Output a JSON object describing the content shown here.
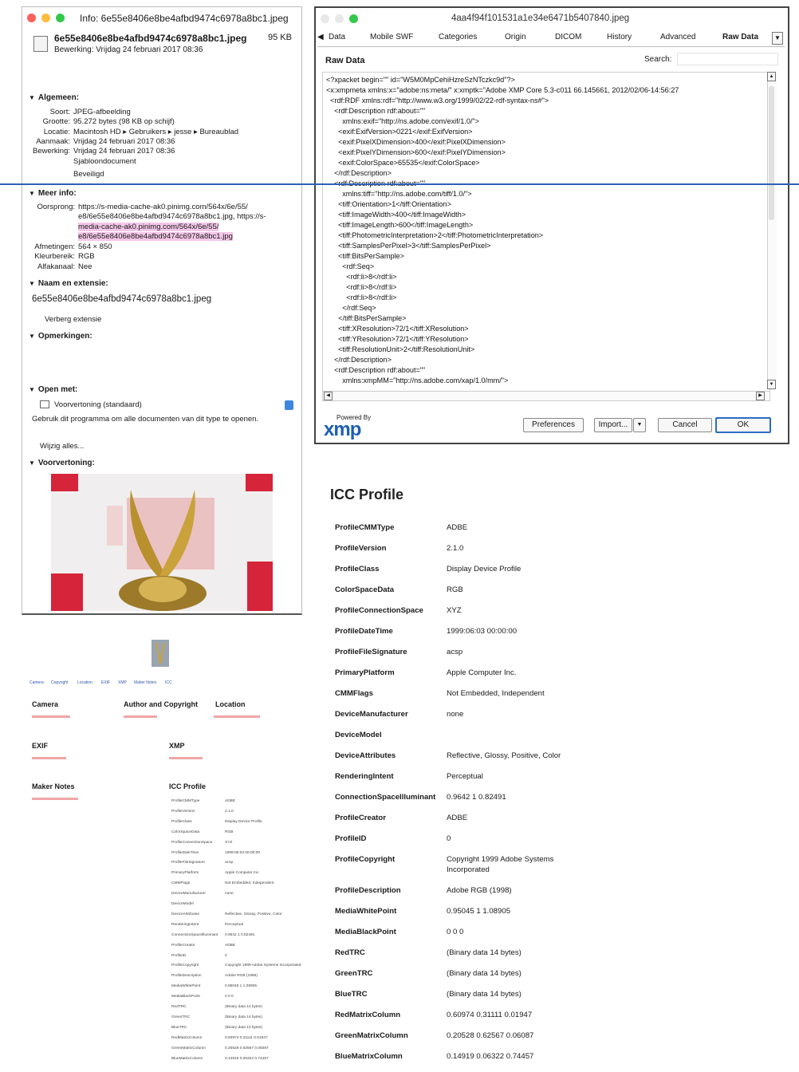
{
  "info_window": {
    "title": "Info: 6e55e8406e8be4afbd9474c6978a8bc1.jpeg",
    "file_name": "6e55e8406e8be4afbd9474c6978a8bc1.jpeg",
    "file_size": "95 KB",
    "edited": "Bewerking: Vrijdag 24 februari 2017 08:36",
    "general": {
      "label": "Algemeen:",
      "rows": [
        {
          "k": "Soort:",
          "v": "JPEG-afbeelding"
        },
        {
          "k": "Grootte:",
          "v": "95.272 bytes (98 KB op schijf)"
        },
        {
          "k": "Locatie:",
          "v": "Macintosh HD ▸ Gebruikers ▸ jesse ▸ Bureaublad"
        },
        {
          "k": "Aanmaak:",
          "v": "Vrijdag 24 februari 2017 08:36"
        },
        {
          "k": "Bewerking:",
          "v": "Vrijdag 24 februari 2017 08:36"
        }
      ],
      "template_label": "Sjabloondocument",
      "locked_label": "Beveiligd"
    },
    "more_info": {
      "label": "Meer info:",
      "origin_key": "Oorsprong:",
      "origin_lines": [
        "https://s-media-cache-ak0.pinimg.com/564x/6e/55/",
        "e8/6e55e8406e8be4afbd9474c6978a8bc1.jpg, https://s-",
        "media-cache-ak0.pinimg.com/564x/6e/55/",
        "e8/6e55e8406e8be4afbd9474c6978a8bc1.jpg"
      ],
      "rows": [
        {
          "k": "Afmetingen:",
          "v": "564 × 850"
        },
        {
          "k": "Kleurbereik:",
          "v": "RGB"
        },
        {
          "k": "Alfakanaal:",
          "v": "Nee"
        }
      ]
    },
    "name_ext": {
      "label": "Naam en extensie:",
      "value": "6e55e8406e8be4afbd9474c6978a8bc1.jpeg",
      "hide_ext": "Verberg extensie"
    },
    "comments": {
      "label": "Opmerkingen:"
    },
    "open_with": {
      "label": "Open met:",
      "app": "Voorvertoning (standaard)",
      "note": "Gebruik dit programma om alle documenten van dit type te openen.",
      "change_all": "Wijzig alles..."
    },
    "preview": {
      "label": "Voorvertoning:"
    }
  },
  "raw_dialog": {
    "title": "4aa4f94f101531a1e34e6471b5407840.jpeg",
    "tabs": [
      "Data",
      "Mobile SWF",
      "Categories",
      "Origin",
      "DICOM",
      "History",
      "Advanced",
      "Raw Data"
    ],
    "active_tab": "Raw Data",
    "header": "Raw Data",
    "search_label": "Search:",
    "xml_lines": [
      "<?xpacket begin=\"\" id=\"W5M0MpCehiHzreSzNTczkc9d\"?>",
      "<x:xmpmeta xmlns:x=\"adobe:ns:meta/\" x:xmptk=\"Adobe XMP Core 5.3-c011 66.145661, 2012/02/06-14:56:27",
      "  <rdf:RDF xmlns:rdf=\"http://www.w3.org/1999/02/22-rdf-syntax-ns#\">",
      "    <rdf:Description rdf:about=\"\"",
      "        xmlns:exif=\"http://ns.adobe.com/exif/1.0/\">",
      "      <exif:ExifVersion>0221</exif:ExifVersion>",
      "      <exif:PixelXDimension>400</exif:PixelXDimension>",
      "      <exif:PixelYDimension>600</exif:PixelYDimension>",
      "      <exif:ColorSpace>65535</exif:ColorSpace>",
      "    </rdf:Description>",
      "    <rdf:Description rdf:about=\"\"",
      "        xmlns:tiff=\"http://ns.adobe.com/tiff/1.0/\">",
      "      <tiff:Orientation>1</tiff:Orientation>",
      "      <tiff:ImageWidth>400</tiff:ImageWidth>",
      "      <tiff:ImageLength>600</tiff:ImageLength>",
      "      <tiff:PhotometricInterpretation>2</tiff:PhotometricInterpretation>",
      "      <tiff:SamplesPerPixel>3</tiff:SamplesPerPixel>",
      "      <tiff:BitsPerSample>",
      "        <rdf:Seq>",
      "          <rdf:li>8</rdf:li>",
      "          <rdf:li>8</rdf:li>",
      "          <rdf:li>8</rdf:li>",
      "        </rdf:Seq>",
      "      </tiff:BitsPerSample>",
      "      <tiff:XResolution>72/1</tiff:XResolution>",
      "      <tiff:YResolution>72/1</tiff:YResolution>",
      "      <tiff:ResolutionUnit>2</tiff:ResolutionUnit>",
      "    </rdf:Description>",
      "    <rdf:Description rdf:about=\"\"",
      "        xmlns:xmpMM=\"http://ns.adobe.com/xap/1.0/mm/\">"
    ],
    "powered_by": "Powered By",
    "xmp_logo": "xmp",
    "buttons": {
      "preferences": "Preferences",
      "import": "Import...",
      "cancel": "Cancel",
      "ok": "OK"
    }
  },
  "icc_profile": {
    "title": "ICC Profile",
    "rows": [
      {
        "k": "ProfileCMMType",
        "v": "ADBE"
      },
      {
        "k": "ProfileVersion",
        "v": "2.1.0"
      },
      {
        "k": "ProfileClass",
        "v": "Display Device Profile"
      },
      {
        "k": "ColorSpaceData",
        "v": "RGB"
      },
      {
        "k": "ProfileConnectionSpace",
        "v": "XYZ"
      },
      {
        "k": "ProfileDateTime",
        "v": "1999:06:03 00:00:00"
      },
      {
        "k": "ProfileFileSignature",
        "v": "acsp"
      },
      {
        "k": "PrimaryPlatform",
        "v": "Apple Computer Inc."
      },
      {
        "k": "CMMFlags",
        "v": "Not Embedded, Independent"
      },
      {
        "k": "DeviceManufacturer",
        "v": "none"
      },
      {
        "k": "DeviceModel",
        "v": ""
      },
      {
        "k": "DeviceAttributes",
        "v": "Reflective, Glossy, Positive, Color"
      },
      {
        "k": "RenderingIntent",
        "v": "Perceptual"
      },
      {
        "k": "ConnectionSpaceIlluminant",
        "v": "0.9642 1 0.82491"
      },
      {
        "k": "ProfileCreator",
        "v": "ADBE"
      },
      {
        "k": "ProfileID",
        "v": "0"
      },
      {
        "k": "ProfileCopyright",
        "v": "Copyright 1999 Adobe Systems Incorporated"
      },
      {
        "k": "ProfileDescription",
        "v": "Adobe RGB (1998)"
      },
      {
        "k": "MediaWhitePoint",
        "v": "0.95045 1 1.08905"
      },
      {
        "k": "MediaBlackPoint",
        "v": "0 0 0"
      },
      {
        "k": "RedTRC",
        "v": "(Binary data 14 bytes)"
      },
      {
        "k": "GreenTRC",
        "v": "(Binary data 14 bytes)"
      },
      {
        "k": "BlueTRC",
        "v": "(Binary data 14 bytes)"
      },
      {
        "k": "RedMatrixColumn",
        "v": "0.60974 0.31111 0.01947"
      },
      {
        "k": "GreenMatrixColumn",
        "v": "0.20528 0.62567 0.06087"
      },
      {
        "k": "BlueMatrixColumn",
        "v": "0.14919 0.06322 0.74457"
      }
    ]
  },
  "mini_page": {
    "nav": [
      "Camera",
      "Copyright",
      "Location",
      "EXIF",
      "XMP",
      "Maker Notes",
      "ICC"
    ],
    "sections": {
      "camera": "Camera",
      "author": "Author and Copyright",
      "location": "Location",
      "exif": "EXIF",
      "xmp": "XMP",
      "maker_notes": "Maker Notes",
      "icc": "ICC Profile"
    }
  },
  "colors": {
    "accent": "#2e63b4",
    "link_pink": "#f4c7e8",
    "close": "#fc605b",
    "minimize": "#fdbc40",
    "zoom": "#34c84a"
  }
}
